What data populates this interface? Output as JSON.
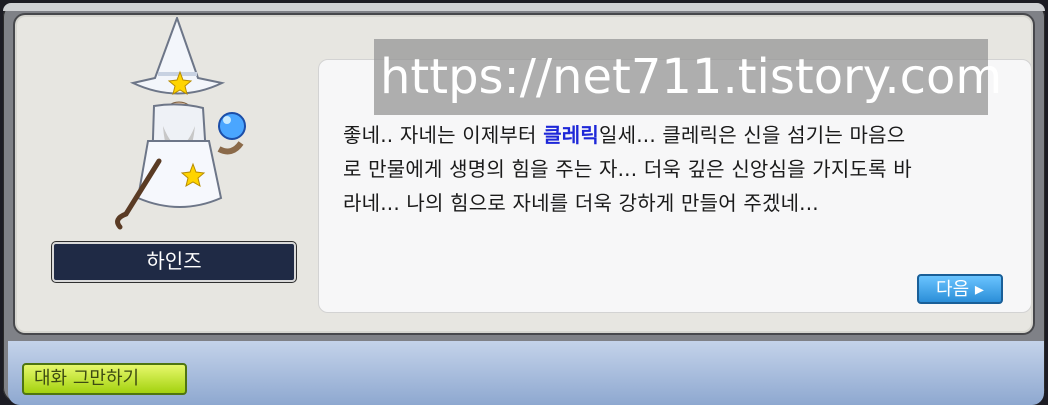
{
  "npc": {
    "name": "하인즈"
  },
  "dialog": {
    "line1_prefix": "좋네.. 자네는 이제부터 ",
    "job_name": "클레릭",
    "line1_suffix": "일세... 클레릭은 신을 섬기는 마음으",
    "line2": "로 만물에게 생명의 힘을 주는 자... 더욱 깊은 신앙심을 가지도록 바",
    "line3": "라네... 나의 힘으로 자네를 더욱 강하게 만들어 주겠네...",
    "next_label": "다음 ▸"
  },
  "watermark": {
    "text": "https://net711.tistory.com"
  },
  "bottom": {
    "end_chat_label": "대화 그만하기"
  },
  "colors": {
    "job_name": "#1d27d8",
    "panel_bg": "#e7e6e1",
    "dialog_bg": "#f7f7f8",
    "name_plate": "#1f2a45"
  },
  "icons": {
    "npc_portrait": "wizard-icon",
    "star": "star-icon",
    "staff": "staff-icon",
    "orb": "orb-icon"
  }
}
